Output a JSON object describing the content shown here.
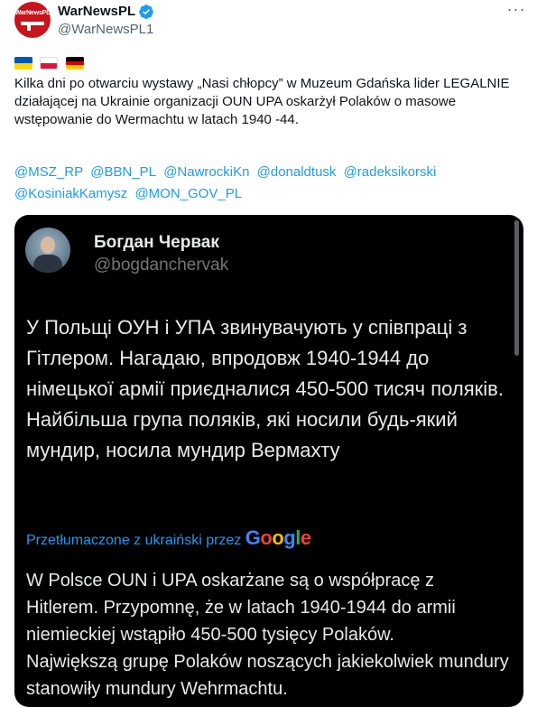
{
  "author": {
    "display_name": "WarNewsPL",
    "handle": "@WarNewsPL1",
    "avatar_logo_text": "WarNewsPL",
    "verified_color": "#1d9bf0"
  },
  "flags": [
    {
      "name": "ukraine-flag-icon",
      "colors": [
        "#0057b7",
        "#ffd700"
      ]
    },
    {
      "name": "poland-flag-icon",
      "colors": [
        "#ffffff",
        "#dc143c"
      ]
    },
    {
      "name": "germany-flag-icon",
      "colors": [
        "#000000",
        "#dd0000",
        "#ffce00"
      ]
    }
  ],
  "tweet": {
    "text": "Kilka dni po otwarciu wystawy „Nasi chłopcy” w Muzeum Gdańska lider LEGALNIE działającej na Ukrainie organizacji OUN UPA oskarżył Polaków o masowe wstępowanie do Wermachtu w latach 1940 -44.",
    "mentions": [
      "@MSZ_RP",
      "@BBN_PL",
      "@NawrockiKn",
      "@donaldtusk",
      "@radeksikorski",
      "@KosiniakKamysz",
      "@MON_GOV_PL"
    ]
  },
  "quoted": {
    "display_name": "Богдан Червак",
    "handle": "@bogdanchervak",
    "original_text": "У Польщі ОУН і УПА звинувачують у співпраці з Гітлером. Нагадаю, впродовж 1940-1944 до німецької армії приєдналися 450-500 тисяч поляків.\nНайбільша група поляків, які носили будь-який мундир, носила мундир Вермахту",
    "translated_label": "Przetłumaczone z ukraiński przez",
    "translator_brand": "Google",
    "translated_text": "W Polsce OUN i UPA oskarżane są o współpracę z Hitlerem. Przypomnę, że w latach 1940-1944 do armii niemieckiej wstąpiło 450-500 tysięcy Polaków.\nNajwiększą grupę Polaków noszących jakiekolwiek mundury stanowiły mundury Wehrmachtu."
  },
  "colors": {
    "link": "#1d9bf0",
    "card_bg": "#000000",
    "google_blue": "#4285f4",
    "google_red": "#ea4335",
    "google_yellow": "#fbbc05",
    "google_green": "#34a853"
  }
}
